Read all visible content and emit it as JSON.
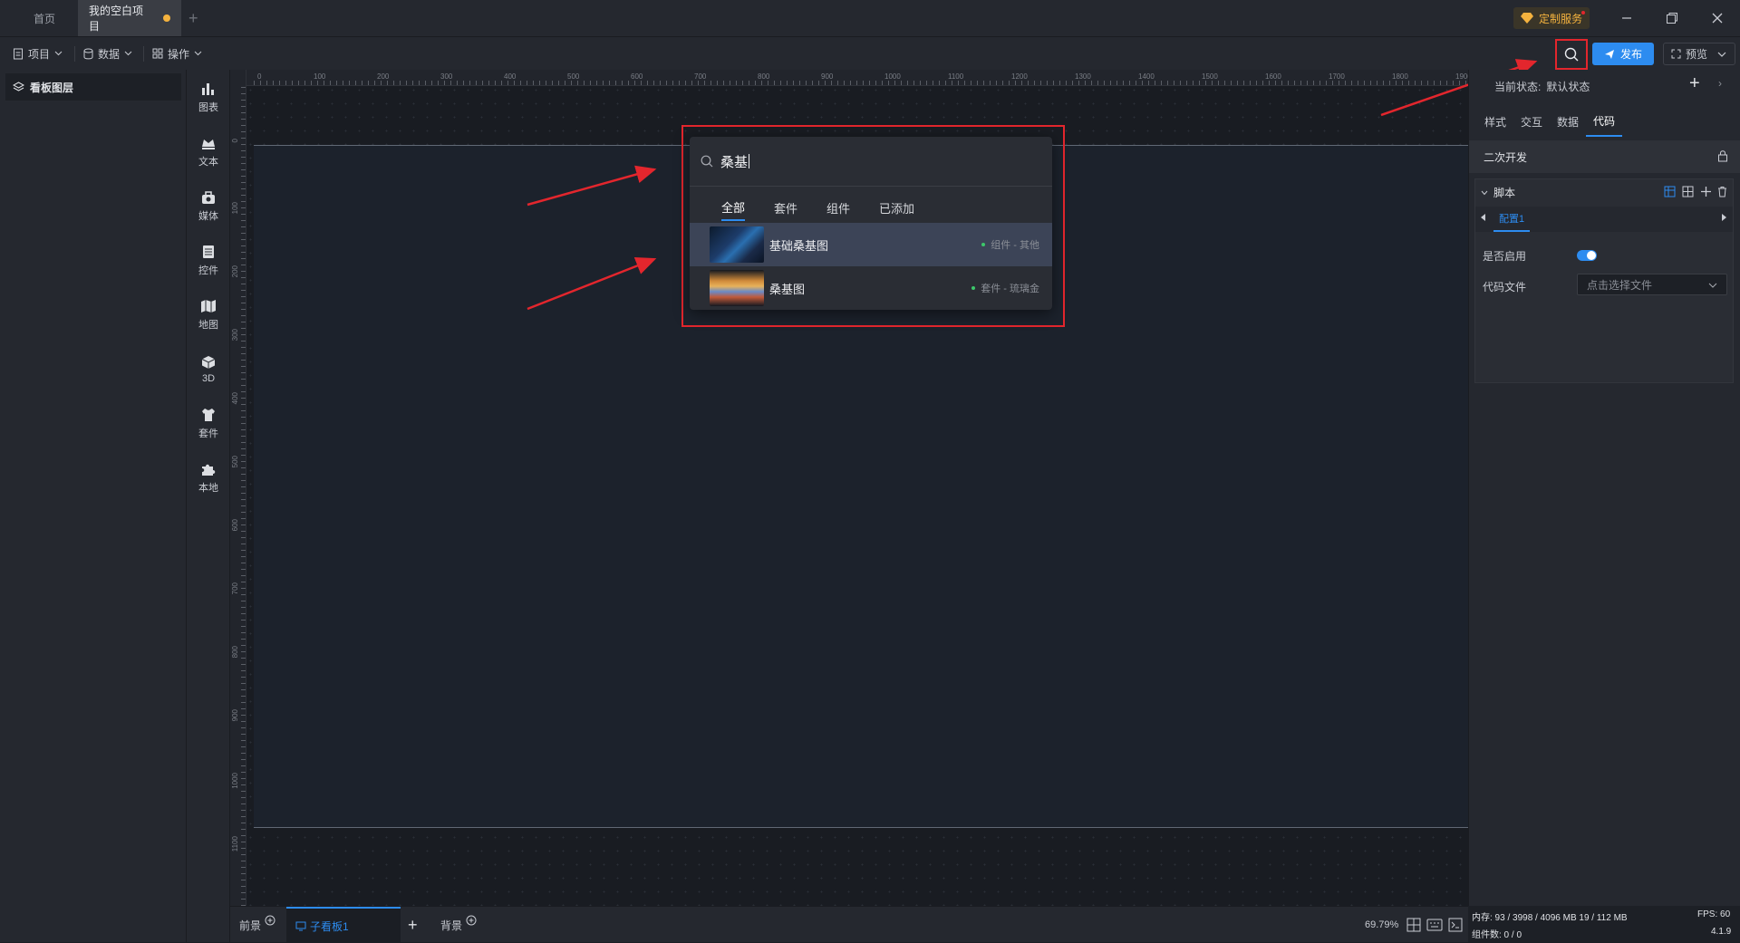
{
  "titlebar": {
    "tabs": [
      {
        "label": "首页"
      },
      {
        "label": "我的空白项目"
      }
    ],
    "custom_service": "定制服务"
  },
  "toolbar": {
    "menus": [
      {
        "label": "项目"
      },
      {
        "label": "数据"
      },
      {
        "label": "操作"
      }
    ],
    "publish_label": "发布",
    "preview_label": "预览"
  },
  "layers": {
    "title": "看板图层"
  },
  "iconbar": {
    "items": [
      {
        "label": "图表",
        "icon": "chart-icon"
      },
      {
        "label": "文本",
        "icon": "text-icon"
      },
      {
        "label": "媒体",
        "icon": "media-icon"
      },
      {
        "label": "控件",
        "icon": "widget-icon"
      },
      {
        "label": "地图",
        "icon": "map-icon"
      },
      {
        "label": "3D",
        "icon": "cube-icon"
      },
      {
        "label": "套件",
        "icon": "suite-icon"
      },
      {
        "label": "本地",
        "icon": "puzzle-icon"
      }
    ]
  },
  "ruler": {
    "h_ticks": [
      "0",
      "100",
      "200",
      "300",
      "400",
      "500",
      "600",
      "700",
      "800",
      "900",
      "1000",
      "1100",
      "1200",
      "1300",
      "1400",
      "1500",
      "1600",
      "1700",
      "1800",
      "1900"
    ],
    "v_ticks": [
      "0",
      "100",
      "200",
      "300",
      "400",
      "500",
      "600",
      "700",
      "800",
      "900",
      "1000",
      "1100"
    ]
  },
  "search_popup": {
    "query": "桑基",
    "tabs": [
      {
        "label": "全部"
      },
      {
        "label": "套件"
      },
      {
        "label": "组件"
      },
      {
        "label": "已添加"
      }
    ],
    "results": [
      {
        "name": "基础桑基图",
        "meta": "组件 - 其他"
      },
      {
        "name": "桑基图",
        "meta": "套件 - 琉璃金"
      }
    ]
  },
  "bottombar": {
    "foreground": "前景",
    "subboard": "子看板1",
    "background": "背景",
    "zoom": "69.79%"
  },
  "rightpanel": {
    "state_label": "当前状态:",
    "state_value": "默认状态",
    "tabs": [
      {
        "label": "样式"
      },
      {
        "label": "交互"
      },
      {
        "label": "数据"
      },
      {
        "label": "代码"
      }
    ],
    "section_title": "二次开发",
    "script_label": "脚本",
    "config_tab": "配置1",
    "enable_label": "是否启用",
    "enable_on": true,
    "codefile_label": "代码文件",
    "codefile_placeholder": "点击选择文件"
  },
  "statusbar": {
    "memory": "内存: 93 / 3998 / 4096 MB 19 / 112 MB",
    "fps": "FPS: 60",
    "components": "组件数: 0 / 0",
    "version": "4.1.9"
  },
  "colors": {
    "accent": "#2d8cf0",
    "annotation": "#e3262d",
    "highlight_row": "#3c4457"
  }
}
